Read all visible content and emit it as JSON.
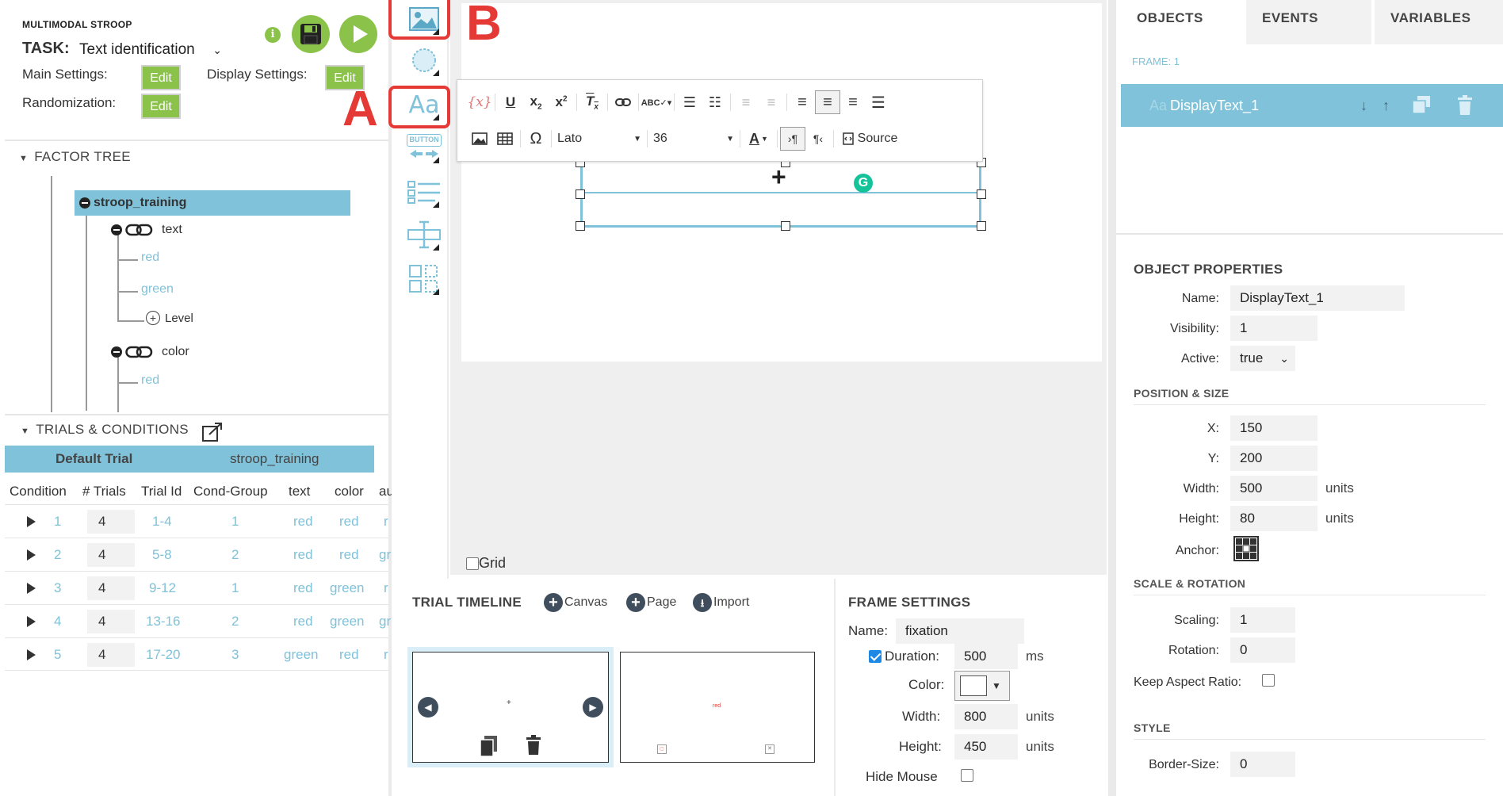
{
  "task_panel": {
    "app_title": "MULTIMODAL STROOP",
    "task_label": "TASK:",
    "task_value": "Text identification",
    "main_settings_label": "Main Settings:",
    "display_settings_label": "Display Settings:",
    "randomization_label": "Randomization:",
    "edit_label": "Edit",
    "info_glyph": "i"
  },
  "factor_tree": {
    "header": "FACTOR TREE",
    "root": "stroop_training",
    "factors": [
      {
        "name": "text",
        "levels": [
          "red",
          "green"
        ],
        "add_level": "Level"
      },
      {
        "name": "color",
        "levels": [
          "red"
        ]
      }
    ]
  },
  "trials": {
    "header": "TRIALS & CONDITIONS",
    "tab_default": "Default Trial",
    "tab_training": "stroop_training",
    "columns": [
      "Condition",
      "# Trials",
      "Trial Id",
      "Cond-Group",
      "text",
      "color",
      "au"
    ],
    "rows": [
      {
        "condition": "1",
        "trials": "4",
        "trial_id": "1-4",
        "group": "1",
        "text": "red",
        "color": "red",
        "extra": "r"
      },
      {
        "condition": "2",
        "trials": "4",
        "trial_id": "5-8",
        "group": "2",
        "text": "red",
        "color": "red",
        "extra": "gr"
      },
      {
        "condition": "3",
        "trials": "4",
        "trial_id": "9-12",
        "group": "1",
        "text": "red",
        "color": "green",
        "extra": "r"
      },
      {
        "condition": "4",
        "trials": "4",
        "trial_id": "13-16",
        "group": "2",
        "text": "red",
        "color": "green",
        "extra": "gr"
      },
      {
        "condition": "5",
        "trials": "4",
        "trial_id": "17-20",
        "group": "3",
        "text": "green",
        "color": "red",
        "extra": "r"
      }
    ]
  },
  "annotations": {
    "a": "A",
    "b": "B"
  },
  "toolbox": {
    "tools": [
      "image-tool-icon",
      "audio-tool-icon",
      "text-tool-icon",
      "button-tool-icon",
      "select-tool-icon",
      "input-tool-icon",
      "layout-tool-icon"
    ],
    "text_tool_glyph": "Aa",
    "button_tool_label": "BUTTON"
  },
  "editor_toolbar": {
    "variable_glyph": "{x}",
    "font_name": "Lato",
    "font_size": "36",
    "source_label": "Source",
    "special_char": "Ω"
  },
  "canvas": {
    "grid_label": "Grid",
    "grid_checked": false,
    "fixation_glyph": "+"
  },
  "timeline": {
    "title": "TRIAL TIMELINE",
    "add_canvas": "Canvas",
    "add_page": "Page",
    "import": "Import",
    "frame2_text": "red"
  },
  "frame_settings": {
    "title": "FRAME SETTINGS",
    "name_label": "Name:",
    "name_value": "fixation",
    "duration_label": "Duration:",
    "duration_checked": true,
    "duration_value": "500",
    "duration_unit": "ms",
    "color_label": "Color:",
    "width_label": "Width:",
    "width_value": "800",
    "height_label": "Height:",
    "height_value": "450",
    "units": "units",
    "hide_mouse_label": "Hide Mouse"
  },
  "right_panel": {
    "tabs": [
      "OBJECTS",
      "EVENTS",
      "VARIABLES"
    ],
    "frame_label": "FRAME: 1",
    "object_name": "DisplayText_1",
    "object_icon_glyph": "Aa",
    "properties_title": "OBJECT PROPERTIES",
    "name_label": "Name:",
    "name_value": "DisplayText_1",
    "visibility_label": "Visibility:",
    "visibility_value": "1",
    "active_label": "Active:",
    "active_value": "true",
    "pos_size_title": "POSITION & SIZE",
    "x_label": "X:",
    "x_value": "150",
    "y_label": "Y:",
    "y_value": "200",
    "width_label": "Width:",
    "width_value": "500",
    "height_label": "Height:",
    "height_value": "80",
    "units": "units",
    "anchor_label": "Anchor:",
    "scale_title": "SCALE & ROTATION",
    "scaling_label": "Scaling:",
    "scaling_value": "1",
    "rotation_label": "Rotation:",
    "rotation_value": "0",
    "aspect_label": "Keep Aspect Ratio:",
    "style_title": "STYLE",
    "border_size_label": "Border-Size:",
    "border_size_value": "0"
  },
  "colors": {
    "accent_green": "#8bc34a",
    "accent_blue": "#7fc2d9",
    "annotation_red": "#e53935"
  }
}
